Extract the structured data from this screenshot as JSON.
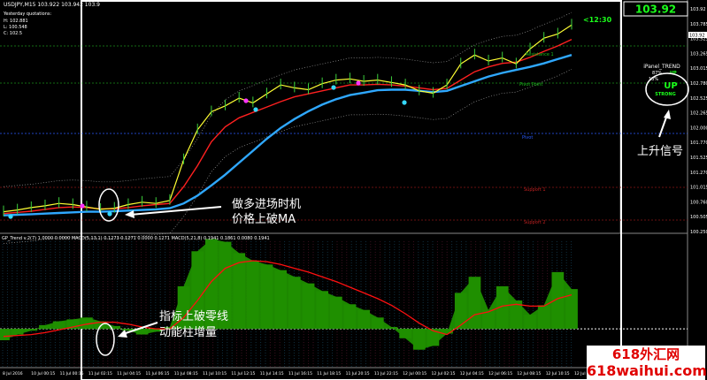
{
  "header": {
    "symbol_line": "USDJPY,M15  103.922 103.942 103.9",
    "yesterday_label": "Yesterday quotations:",
    "H": "H: 102.881",
    "L": "L: 100.548",
    "C": "C: 102.5"
  },
  "price_box": "103.92",
  "countdown": "<12:30",
  "ipanel": {
    "title": "iPanel_TREND",
    "pct": "87%",
    "pct2": "13%",
    "dir_up": "UP",
    "signal_up": "UP",
    "signal_strength": "STRONG"
  },
  "annotations": {
    "rise_signal": "上升信号",
    "entry_line1": "做多进场时机",
    "entry_line2": "价格上破MA",
    "indicator_line1": "指标上破零线",
    "indicator_line2": "动能柱增量"
  },
  "level_labels": {
    "resistance1": "Resistance 1",
    "pivot": "Pivot",
    "pivot_right": "Pivot Point",
    "support1": "Support 1",
    "support2": "Support 2",
    "resistance2": "Resistance 2"
  },
  "indicator_header": "GP_Trend v.2(7) 1.0000 0.0000  MACD(5,13,1) 0.1273 0.1271 0.0000 0.1271  MACD(5,21,8) 0.1941 0.1861 0.0080 0.1941",
  "watermark": {
    "line1": "618外汇网",
    "line2": "618waihui.com"
  },
  "colors": {
    "price": "#ffff33",
    "ma_fast": "#ff2020",
    "ma_slow": "#2fa8ff",
    "histogram": "#1f8f00",
    "signal": "#ff1010",
    "background": "#000000",
    "highlight": "#ffffff",
    "up_signal": "#1bff1b"
  },
  "chart_data": [
    {
      "type": "line",
      "title": "USDJPY,M15",
      "ylim": [
        100.25,
        104.0
      ],
      "y_ticks": [
        "103.92",
        "103.785",
        "103.525",
        "103.265",
        "103.015",
        "102.780",
        "102.525",
        "102.265",
        "102.000",
        "101.770",
        "101.525",
        "101.270",
        "101.015",
        "100.760",
        "100.505",
        "100.250"
      ],
      "x_ticks": [
        "8 Jul 2016",
        "10 Jul 00:15",
        "11 Jul 00:15",
        "11 Jul 02:15",
        "11 Jul 04:15",
        "11 Jul 06:15",
        "11 Jul 08:15",
        "11 Jul 10:15",
        "11 Jul 12:15",
        "11 Jul 14:15",
        "11 Jul 16:15",
        "11 Jul 18:15",
        "11 Jul 20:15",
        "11 Jul 22:15",
        "12 Jul 00:15",
        "12 Jul 02:15",
        "12 Jul 04:15",
        "12 Jul 06:15",
        "12 Jul 08:15",
        "12 Jul 10:15",
        "12 Jul 12:15"
      ],
      "series": [
        {
          "values": [
            100.58,
            100.61,
            100.65,
            100.68,
            100.72,
            100.7,
            100.66,
            100.62,
            100.64,
            100.7,
            100.74,
            100.72,
            100.77,
            101.45,
            101.95,
            102.25,
            102.35,
            102.48,
            102.4,
            102.55,
            102.7,
            102.65,
            102.62,
            102.72,
            102.78,
            102.8,
            102.76,
            102.78,
            102.74,
            102.7,
            102.6,
            102.56,
            102.7,
            103.05,
            103.2,
            103.1,
            103.15,
            103.05,
            103.3,
            103.48,
            103.55,
            103.7
          ]
        },
        {
          "values": [
            100.55,
            100.57,
            100.59,
            100.62,
            100.65,
            100.66,
            100.65,
            100.63,
            100.63,
            100.65,
            100.68,
            100.7,
            100.72,
            101.0,
            101.35,
            101.75,
            102.0,
            102.15,
            102.24,
            102.33,
            102.42,
            102.5,
            102.55,
            102.6,
            102.65,
            102.7,
            102.7,
            102.71,
            102.7,
            102.68,
            102.65,
            102.62,
            102.64,
            102.78,
            102.92,
            103.0,
            103.06,
            103.08,
            103.16,
            103.26,
            103.35,
            103.46
          ]
        },
        {
          "values": [
            100.52,
            100.53,
            100.54,
            100.55,
            100.56,
            100.57,
            100.58,
            100.58,
            100.59,
            100.6,
            100.61,
            100.62,
            100.64,
            100.72,
            100.85,
            101.02,
            101.2,
            101.4,
            101.6,
            101.8,
            101.98,
            102.13,
            102.26,
            102.37,
            102.46,
            102.53,
            102.57,
            102.61,
            102.62,
            102.62,
            102.6,
            102.58,
            102.6,
            102.68,
            102.76,
            102.84,
            102.9,
            102.95,
            103.0,
            103.06,
            103.13,
            103.2
          ]
        }
      ]
    },
    {
      "type": "bar",
      "title": "MACD",
      "ylim": [
        -0.4,
        1.0
      ],
      "series": [
        {
          "values": [
            -0.12,
            -0.06,
            -0.02,
            0.04,
            0.08,
            0.1,
            0.12,
            0.08,
            0.03,
            -0.02,
            -0.06,
            -0.03,
            0.02,
            0.45,
            0.82,
            0.95,
            0.92,
            0.8,
            0.72,
            0.68,
            0.62,
            0.55,
            0.48,
            0.4,
            0.34,
            0.26,
            0.2,
            0.12,
            0.02,
            -0.1,
            -0.22,
            -0.18,
            -0.05,
            0.38,
            0.55,
            0.2,
            0.45,
            0.3,
            0.15,
            0.25,
            0.6,
            0.42
          ]
        },
        {
          "values": [
            -0.08,
            -0.07,
            -0.06,
            -0.04,
            -0.01,
            0.02,
            0.05,
            0.07,
            0.07,
            0.05,
            0.02,
            0.0,
            0.0,
            0.12,
            0.3,
            0.5,
            0.64,
            0.7,
            0.72,
            0.71,
            0.68,
            0.64,
            0.6,
            0.55,
            0.5,
            0.44,
            0.38,
            0.32,
            0.25,
            0.16,
            0.06,
            -0.02,
            -0.06,
            0.04,
            0.15,
            0.18,
            0.24,
            0.26,
            0.24,
            0.24,
            0.32,
            0.36
          ]
        }
      ]
    }
  ]
}
